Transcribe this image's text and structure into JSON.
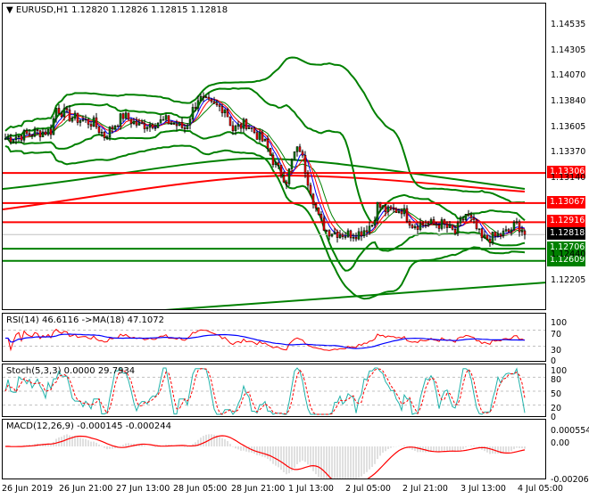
{
  "header": {
    "symbol": "EURUSD,H1",
    "open": "1.12820",
    "high": "1.12826",
    "low": "1.12815",
    "close": "1.12818"
  },
  "price_axis": [
    "1.14535",
    "1.14305",
    "1.14070",
    "1.13840",
    "1.13605",
    "1.13370",
    "1.13140",
    "1.12440",
    "1.12205"
  ],
  "levels": [
    {
      "price": 1.13306,
      "label": "1.13306",
      "color": "#ff0000"
    },
    {
      "price": 1.13067,
      "label": "1.13067",
      "color": "#ff0000"
    },
    {
      "price": 1.12916,
      "label": "1.12916",
      "color": "#ff0000"
    },
    {
      "price": 1.12818,
      "label": "1.12818",
      "color": "#000000"
    },
    {
      "price": 1.12706,
      "label": "1.12706",
      "color": "#008000"
    },
    {
      "price": 1.12609,
      "label": "1.12609",
      "color": "#008000"
    }
  ],
  "price_path": [
    [
      0,
      1.1358
    ],
    [
      10,
      1.1362
    ],
    [
      17,
      1.1364
    ],
    [
      19,
      1.1382
    ],
    [
      24,
      1.1375
    ],
    [
      33,
      1.137
    ],
    [
      37,
      1.136
    ],
    [
      44,
      1.1376
    ],
    [
      50,
      1.1368
    ],
    [
      60,
      1.1372
    ],
    [
      67,
      1.1366
    ],
    [
      72,
      1.139
    ],
    [
      77,
      1.1384
    ],
    [
      82,
      1.1382
    ],
    [
      85,
      1.1365
    ],
    [
      90,
      1.137
    ],
    [
      97,
      1.1354
    ],
    [
      101,
      1.1336
    ],
    [
      105,
      1.1325
    ],
    [
      108,
      1.1346
    ],
    [
      110,
      1.135
    ],
    [
      113,
      1.1325
    ],
    [
      117,
      1.1295
    ],
    [
      120,
      1.1285
    ],
    [
      127,
      1.1282
    ],
    [
      132,
      1.1283
    ],
    [
      137,
      1.129
    ],
    [
      139,
      1.1305
    ],
    [
      143,
      1.13
    ],
    [
      148,
      1.1302
    ],
    [
      152,
      1.129
    ],
    [
      157,
      1.129
    ],
    [
      163,
      1.129
    ],
    [
      168,
      1.1283
    ],
    [
      172,
      1.1298
    ],
    [
      175,
      1.129
    ],
    [
      178,
      1.1278
    ],
    [
      183,
      1.128
    ],
    [
      188,
      1.1284
    ],
    [
      191,
      1.129
    ],
    [
      195,
      1.12818
    ]
  ],
  "rsi": {
    "label": "RSI(14) 46.6116  ->MA(18) 47.1072",
    "axis": [
      "100",
      "70",
      "30",
      "0"
    ]
  },
  "stoch": {
    "label": "Stoch(5,3,3) 0.0000 29.7934",
    "axis": [
      "100",
      "80",
      "50",
      "20",
      "0"
    ]
  },
  "macd": {
    "label": "MACD(12,26,9) -0.000145 -0.000244",
    "axis": [
      "0.000554",
      "0.00",
      "-0.002061"
    ]
  },
  "time_axis": [
    "26 Jun 2019",
    "26 Jun 21:00",
    "27 Jun 13:00",
    "28 Jun 05:00",
    "28 Jun 21:00",
    "1 Jul 13:00",
    "2 Jul 05:00",
    "2 Jul 21:00",
    "3 Jul 13:00",
    "4 Jul 05:00"
  ],
  "colors": {
    "bull": "#008000",
    "bear": "#ff0000",
    "band": "#008000",
    "ma_fast": "#0000ff",
    "ma_mid": "#ff0000",
    "signal": "#ff0000",
    "stoch_main": "#20b2aa"
  }
}
